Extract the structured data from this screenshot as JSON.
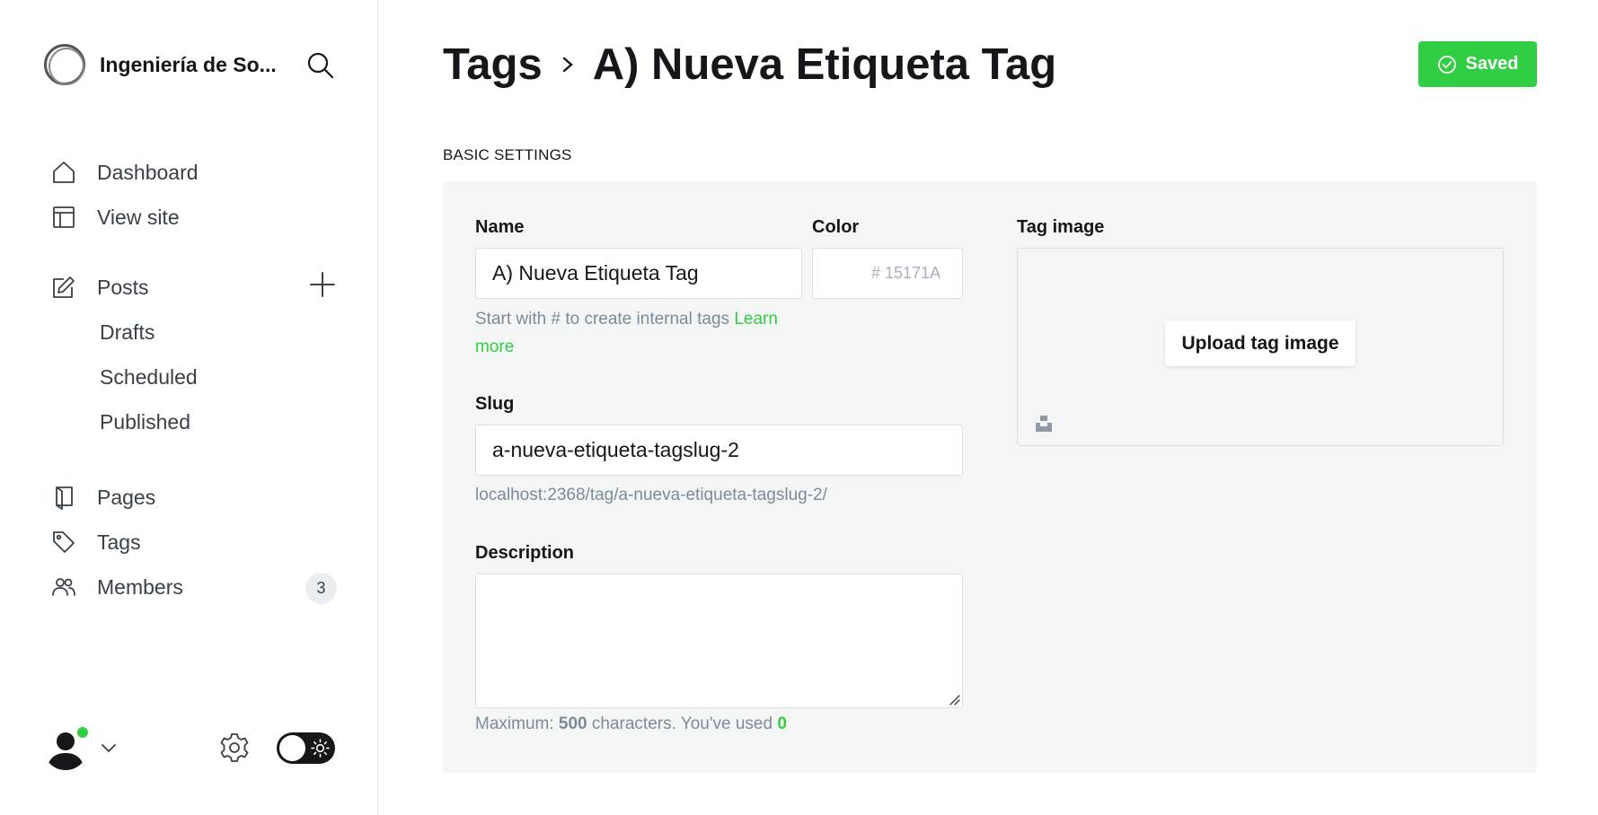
{
  "sidebar": {
    "site_name": "Ingeniería de So...",
    "nav": [
      {
        "label": "Dashboard",
        "icon": "home-icon"
      },
      {
        "label": "View site",
        "icon": "layout-icon"
      },
      {
        "label": "Posts",
        "icon": "edit-icon"
      },
      {
        "label": "Pages",
        "icon": "page-icon"
      },
      {
        "label": "Tags",
        "icon": "tag-icon"
      },
      {
        "label": "Members",
        "icon": "members-icon"
      }
    ],
    "posts_sub": [
      "Drafts",
      "Scheduled",
      "Published"
    ],
    "members_count": "3"
  },
  "header": {
    "breadcrumb_parent": "Tags",
    "breadcrumb_current": "A) Nueva Etiqueta Tag",
    "saved_label": "Saved"
  },
  "form": {
    "section_title": "BASIC SETTINGS",
    "name_label": "Name",
    "name_value": "A) Nueva Etiqueta Tag",
    "name_hint": "Start with # to create internal tags ",
    "name_hint_link": "Learn more",
    "color_label": "Color",
    "color_placeholder": "# 15171A",
    "slug_label": "Slug",
    "slug_value": "a-nueva-etiqueta-tagslug-2",
    "slug_url": "localhost:2368/tag/a-nueva-etiqueta-tagslug-2/",
    "description_label": "Description",
    "description_value": "",
    "counter_prefix": "Maximum: ",
    "counter_max": "500",
    "counter_middle": " characters. You've used ",
    "counter_used": "0",
    "tag_image_label": "Tag image",
    "upload_label": "Upload tag image"
  },
  "colors": {
    "accent_green": "#30cf43",
    "text_dark": "#15171a",
    "panel_bg": "#f4f5f5"
  }
}
